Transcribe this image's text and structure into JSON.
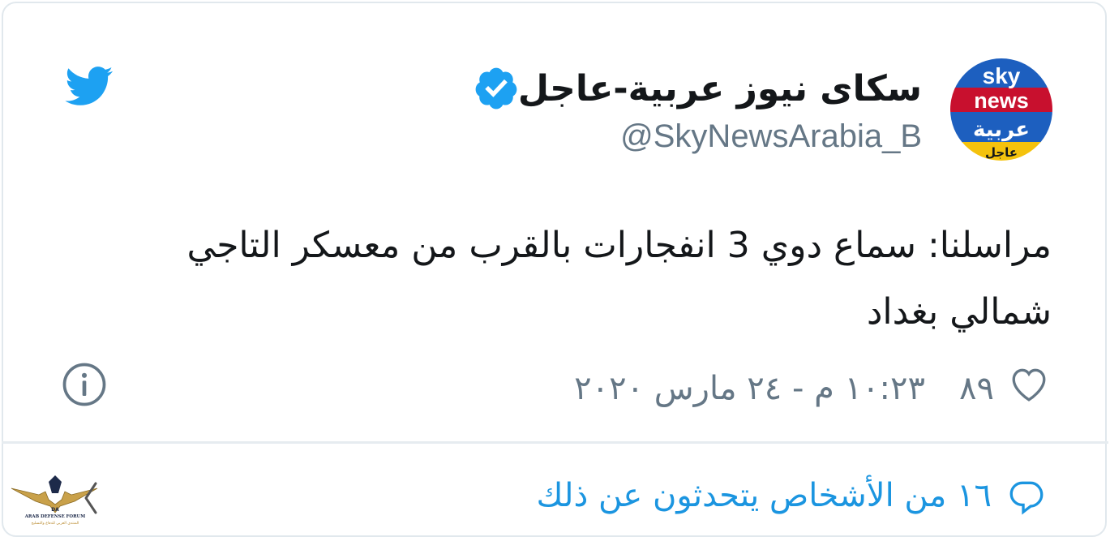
{
  "tweet": {
    "display_name": "سكاى نيوز عربية-عاجل",
    "handle": "@SkyNewsArabia_B",
    "text": "مراسلنا: سماع دوي 3 انفجارات بالقرب من معسكر التاجي شمالي بغداد",
    "like_count": "٨٩",
    "timestamp": "١٠:٢٣ م - ٢٤ مارس ٢٠٢٠",
    "reply_text": "١٦ من الأشخاص يتحدثون عن ذلك"
  },
  "avatar": {
    "line1": "sky",
    "line2": "news",
    "line3": "عربية",
    "line4": "عاجل"
  },
  "watermark": {
    "title": "ARAB DEFENSE FORUM",
    "subtitle": "المنتدى العربي للدفاع والتسليح",
    "mark": "DA"
  },
  "icons": {
    "verified": "verified-badge-icon",
    "bird": "twitter-bird-icon",
    "heart": "heart-icon",
    "info": "info-icon",
    "reply": "reply-bubble-icon",
    "chevron": "chevron-left-icon"
  },
  "colors": {
    "twitter_blue": "#1da1f2",
    "link_blue": "#1b95e0",
    "text": "#14171a",
    "muted": "#657786"
  }
}
